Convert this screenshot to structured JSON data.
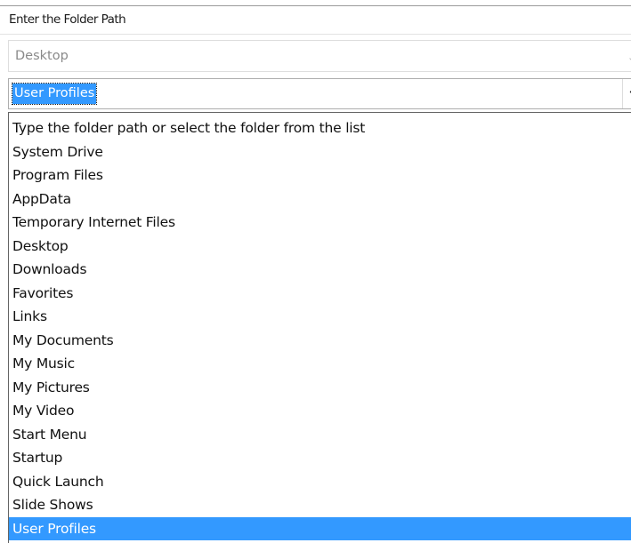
{
  "dialog": {
    "heading": "Enter the Folder Path"
  },
  "path_combo": {
    "value": "Desktop",
    "chevron_icon": "chevron-down-icon"
  },
  "folder_combo": {
    "selected": "User Profiles",
    "chevron_icon": "chevron-down-icon"
  },
  "dropdown": {
    "selected_index": 18,
    "options": [
      {
        "label": "Type the folder path or select the folder from the list"
      },
      {
        "label": "System Drive"
      },
      {
        "label": "Program Files"
      },
      {
        "label": "AppData"
      },
      {
        "label": "Temporary Internet Files"
      },
      {
        "label": "Desktop"
      },
      {
        "label": "Downloads"
      },
      {
        "label": "Favorites"
      },
      {
        "label": "Links"
      },
      {
        "label": "My Documents"
      },
      {
        "label": "My Music"
      },
      {
        "label": "My Pictures"
      },
      {
        "label": "My Video"
      },
      {
        "label": "Start Menu"
      },
      {
        "label": "Startup"
      },
      {
        "label": "Quick Launch"
      },
      {
        "label": "Slide Shows"
      },
      {
        "label": "User Profiles"
      }
    ]
  },
  "colors": {
    "highlight": "#3399ff",
    "highlight_text": "#ffffff",
    "text": "#111111",
    "muted_text": "#8a8a8a"
  }
}
